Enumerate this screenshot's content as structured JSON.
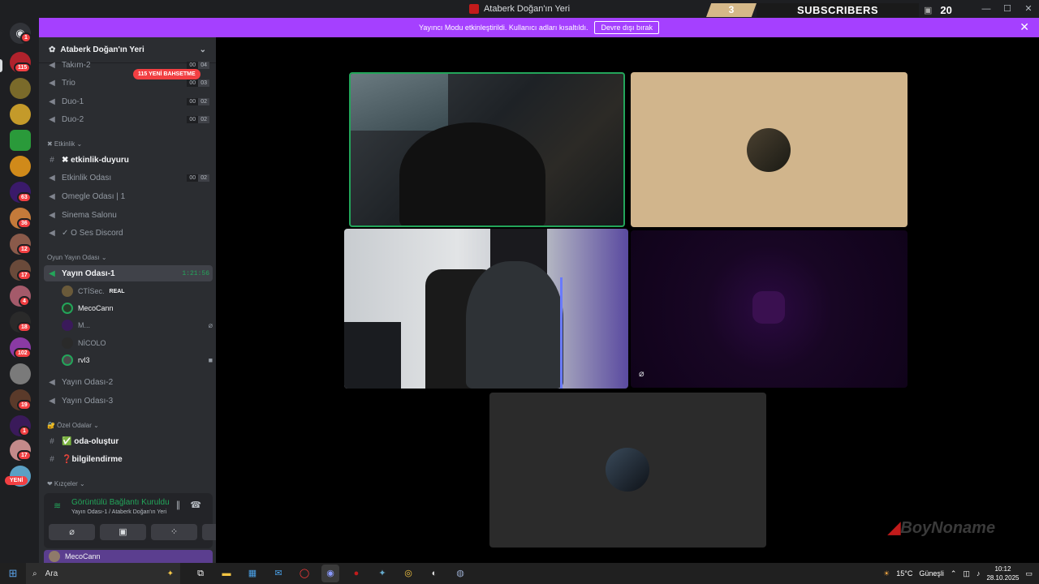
{
  "window": {
    "title": "Ataberk Doğan'ın Yeri",
    "controls": [
      "—",
      "☐",
      "✕"
    ]
  },
  "subscriber_overlay": {
    "count": "3",
    "label": "SUBSCRIBERS",
    "goal": "20"
  },
  "banner": {
    "message": "Yayıncı Modu etkinleştirildi. Kullanıcı adları kısaltıldı.",
    "button": "Devre dışı bırak",
    "close": "✕"
  },
  "server_rail": {
    "badges": [
      "1",
      "115",
      "63",
      "36",
      "12",
      "17",
      "4",
      "18",
      "102",
      "19",
      "1",
      "17"
    ],
    "new_label": "YENİ"
  },
  "sidebar": {
    "server_name": "Ataberk Doğan'ın Yeri",
    "mention_pill": "115 YENİ BAHSETME",
    "channels_top": [
      {
        "label": "Takım-2",
        "a": "00",
        "b": "04"
      },
      {
        "label": "Trio",
        "a": "00",
        "b": "03"
      },
      {
        "label": "Duo-1",
        "a": "00",
        "b": "02"
      },
      {
        "label": "Duo-2",
        "a": "00",
        "b": "02"
      }
    ],
    "cat_etkinlik": "✖ Etkinlik ⌄",
    "etkinlik_duyuru": "✖ etkinlik-duyuru",
    "etkinlik_odasi": {
      "label": "Etkinlik Odası",
      "a": "00",
      "b": "02"
    },
    "omegle": "Omegle Odası | 1",
    "sinema": "Sinema Salonu",
    "oses": "✓ O Ses Discord",
    "cat_oyun": "Oyun Yayın Odası ⌄",
    "yayin1": "Yayın Odası-1",
    "yayin1_timer": "1:21:56",
    "users": [
      {
        "name": "CTİSec.",
        "tag": "REAL"
      },
      {
        "name": "MecoCann",
        "tag": ""
      },
      {
        "name": "M...",
        "tag": ""
      },
      {
        "name": "NİCOLO",
        "tag": ""
      },
      {
        "name": "rvl3",
        "tag": ""
      }
    ],
    "yayin2": "Yayın Odası-2",
    "yayin3": "Yayın Odası-3",
    "cat_ozel": "🔐 Özel Odalar ⌄",
    "oda_olustur": "✅ oda-oluştur",
    "bilgilendirme": "❓bilgilendirme",
    "cat_kizceler": "❤ Kızçeler ⌄"
  },
  "voice_panel": {
    "status": "Görüntülü Bağlantı Kuruldu",
    "location": "Yayın Odası-1 / Ataberk Doğan'ın Yeri",
    "user": "MecoCann"
  },
  "stage": {
    "watermark": "BoyNoname"
  },
  "taskbar": {
    "search": "Ara",
    "weather_temp": "15°C",
    "weather_text": "Güneşli",
    "time": "10:12",
    "date": "28.10.2025"
  },
  "colors": {
    "accent_purple": "#a540ff",
    "discord_green": "#23a55a",
    "badge_red": "#f23f42"
  }
}
